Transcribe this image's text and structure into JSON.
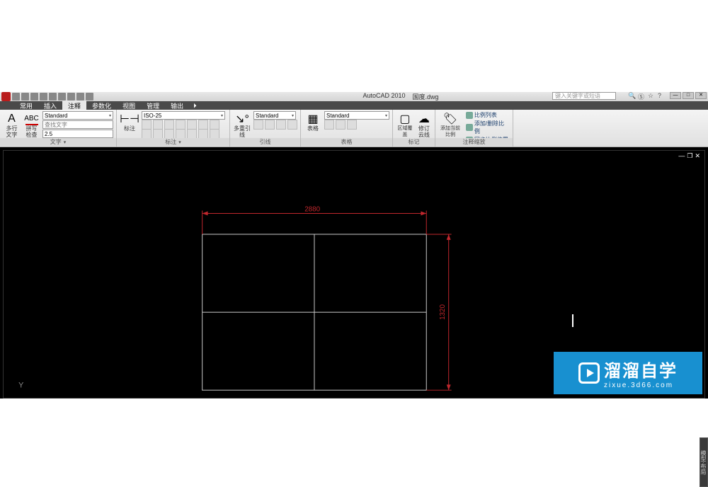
{
  "title": {
    "app": "AutoCAD 2010",
    "file": "国度.dwg",
    "search_placeholder": "键入关键字或短语"
  },
  "tabs": [
    "常用",
    "插入",
    "注释",
    "参数化",
    "视图",
    "管理",
    "输出"
  ],
  "active_tab": 2,
  "ribbon": {
    "text_panel": {
      "title": "文字",
      "multiline": "多行\n文字",
      "spellcheck": "拼写\n检查",
      "style_label": "Standard",
      "find_placeholder": "查找文字",
      "height": "2.5"
    },
    "dim_panel": {
      "title": "标注",
      "dim_btn": "标注",
      "style": "ISO-25"
    },
    "leader_panel": {
      "title": "引线",
      "btn": "多重引线",
      "style": "Standard"
    },
    "table_panel": {
      "title": "表格",
      "btn": "表格",
      "style": "Standard"
    },
    "markup_panel": {
      "title": "标记",
      "wipeout": "区域覆盖",
      "revcloud": "修订\n云线"
    },
    "scale_panel": {
      "title": "注释缩放",
      "addcurrent": "添加当前\n比例 ",
      "links": [
        "比例列表",
        "添加/删除比例",
        "同步比例位置"
      ]
    }
  },
  "chart_data": {
    "type": "table",
    "description": "CAD drawing of a 2x2 rectangular grid with linear dimensions",
    "grid": {
      "rows": 2,
      "cols": 2
    },
    "dim_horizontal": {
      "value": 2880,
      "label": "2880"
    },
    "dim_vertical": {
      "value": 1320,
      "label": "1320"
    },
    "ucs_axes": [
      "Y"
    ]
  },
  "watermark": {
    "name": "溜溜自学",
    "url": "zixue.3d66.com"
  },
  "sidebar_label": "模型·布局"
}
